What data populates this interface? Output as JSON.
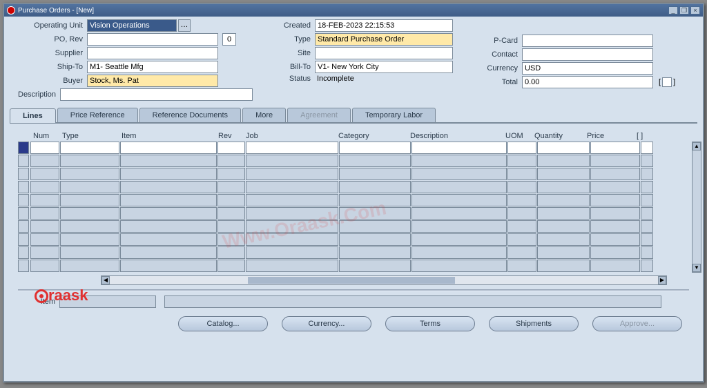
{
  "window": {
    "title": "Purchase Orders - [New]"
  },
  "labels": {
    "operating_unit": "Operating Unit",
    "po_rev": "PO, Rev",
    "supplier": "Supplier",
    "ship_to": "Ship-To",
    "buyer": "Buyer",
    "description": "Description",
    "created": "Created",
    "type": "Type",
    "site": "Site",
    "bill_to": "Bill-To",
    "status": "Status",
    "pcard": "P-Card",
    "contact": "Contact",
    "currency": "Currency",
    "total": "Total",
    "item": "Item"
  },
  "header": {
    "operating_unit": "Vision Operations",
    "po": "",
    "rev": "0",
    "supplier": "",
    "ship_to": "M1- Seattle Mfg",
    "buyer": "Stock, Ms. Pat",
    "description": "",
    "created": "18-FEB-2023 22:15:53",
    "type": "Standard Purchase Order",
    "site": "",
    "bill_to": "V1- New York City",
    "status": "Incomplete",
    "pcard": "",
    "contact": "",
    "currency": "USD",
    "total": "0.00"
  },
  "tabs": {
    "lines": "Lines",
    "price_ref": "Price Reference",
    "ref_docs": "Reference Documents",
    "more": "More",
    "agreement": "Agreement",
    "temp_labor": "Temporary Labor"
  },
  "grid": {
    "columns": {
      "num": "Num",
      "type": "Type",
      "item": "Item",
      "rev": "Rev",
      "job": "Job",
      "category": "Category",
      "description": "Description",
      "uom": "UOM",
      "quantity": "Quantity",
      "price": "Price",
      "overflow": "[ ]"
    }
  },
  "buttons": {
    "catalog": "Catalog...",
    "currency": "Currency...",
    "terms": "Terms",
    "shipments": "Shipments",
    "approve": "Approve..."
  }
}
